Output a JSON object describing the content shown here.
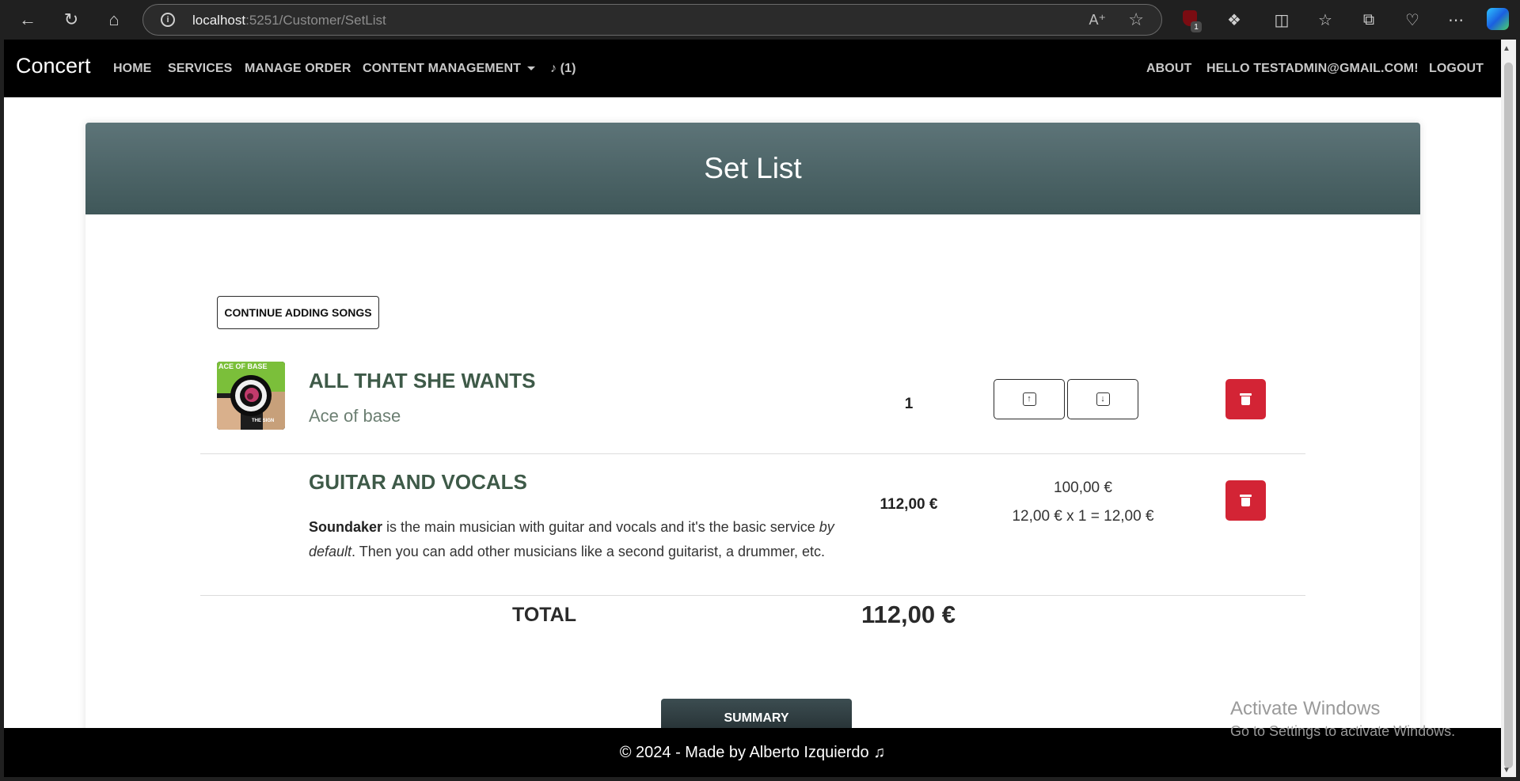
{
  "browser": {
    "url_host": "localhost",
    "url_rest": ":5251/Customer/SetList",
    "ublock_badge": "1",
    "icons": [
      "back-icon",
      "refresh-icon",
      "home-icon",
      "info-icon",
      "read-aloud-icon",
      "favorite-star-icon",
      "ublock-icon",
      "extensions-icon",
      "split-screen-icon",
      "favorites-icon",
      "collections-icon",
      "browser-essentials-icon",
      "more-icon",
      "copilot-icon"
    ]
  },
  "nav": {
    "brand": "Concert",
    "links": [
      "HOME",
      "SERVICES",
      "MANAGE ORDER",
      "CONTENT MANAGEMENT"
    ],
    "cart": "(1)",
    "right_links": [
      "ABOUT",
      "HELLO TESTADMIN@GMAIL.COM!",
      "LOGOUT"
    ]
  },
  "page": {
    "title": "Set List",
    "continue_label": "CONTINUE ADDING SONGS"
  },
  "song": {
    "title": "ALL THAT SHE WANTS",
    "artist": "Ace of base",
    "position": "1",
    "album_text_top": "ACE OF BASE",
    "album_text_bottom": "THE SIGN"
  },
  "service": {
    "title": "GUITAR AND VOCALS",
    "desc_bold": "Soundaker",
    "desc_part1": " is the main musician with guitar and vocals and it's the basic service ",
    "desc_italic": "by default",
    "desc_part2": ". Then you can add other musicians like a second guitarist, a drummer, etc.",
    "price": "112,00 €",
    "base_price": "100,00 €",
    "calc": "12,00 € x 1 = 12,00 €"
  },
  "totals": {
    "label": "TOTAL",
    "value": "112,00 €",
    "summary_label": "SUMMARY"
  },
  "footer": {
    "text": "© 2024 - Made by Alberto Izquierdo ♫"
  },
  "watermark": {
    "line1": "Activate Windows",
    "line2": "Go to Settings to activate Windows."
  }
}
